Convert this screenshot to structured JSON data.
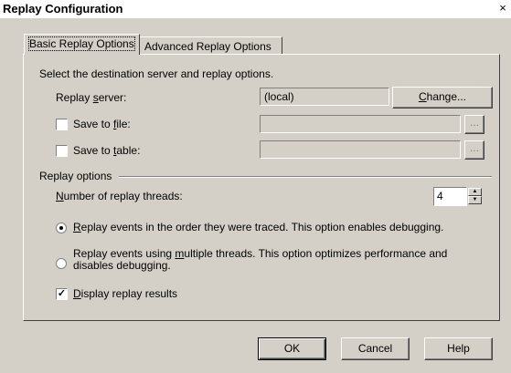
{
  "window": {
    "title": "Replay Configuration",
    "close_glyph": "×"
  },
  "tabs": [
    {
      "label": "Basic Replay Options",
      "selected": true
    },
    {
      "label": "Advanced Replay Options",
      "selected": false
    }
  ],
  "basic": {
    "intro": "Select the destination server and replay options.",
    "replay_server": {
      "label_pre": "Replay ",
      "label_key": "s",
      "label_post": "erver:",
      "value": "(local)",
      "change_pre": "",
      "change_key": "C",
      "change_post": "hange..."
    },
    "save_to_file": {
      "label_pre": "Save to ",
      "label_key": "f",
      "label_post": "ile:",
      "checked": false,
      "value": "",
      "browse_label": "..."
    },
    "save_to_table": {
      "label_pre": "Save to ",
      "label_key": "t",
      "label_post": "able:",
      "checked": false,
      "value": "",
      "browse_label": "..."
    }
  },
  "replay_options": {
    "heading": "Replay options",
    "threads_label_pre": "",
    "threads_label_key": "N",
    "threads_label_post": "umber of replay threads:",
    "threads_value": "4",
    "radio_ordered": {
      "key": "R",
      "rest": "eplay events in the order they were traced. This option enables debugging.",
      "selected": true
    },
    "radio_multi": {
      "pre": "Replay events using ",
      "key": "m",
      "post": "ultiple threads. This option optimizes performance and",
      "line2": "disables debugging.",
      "selected": false
    },
    "display_results": {
      "key": "D",
      "rest": "isplay replay results",
      "checked": true
    }
  },
  "footer": {
    "ok": "OK",
    "cancel": "Cancel",
    "help": "Help"
  },
  "icons": {
    "check": "check-mark-icon",
    "spin_up": "spin-up-arrow-icon",
    "spin_down": "spin-down-arrow-icon"
  }
}
